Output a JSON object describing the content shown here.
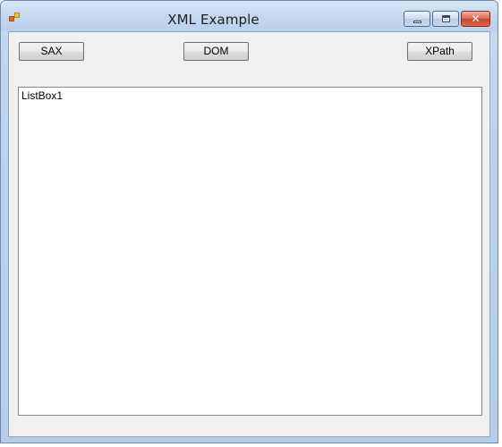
{
  "window": {
    "title": "XML Example",
    "app_icon": "winforms-app-icon",
    "controls": {
      "minimize_icon": "minimize-icon",
      "maximize_icon": "maximize-icon",
      "close_icon": "close-icon",
      "close_glyph": "✕"
    }
  },
  "toolbar": {
    "sax_label": "SAX",
    "dom_label": "DOM",
    "xpath_label": "XPath"
  },
  "listbox": {
    "label": "ListBox1"
  }
}
